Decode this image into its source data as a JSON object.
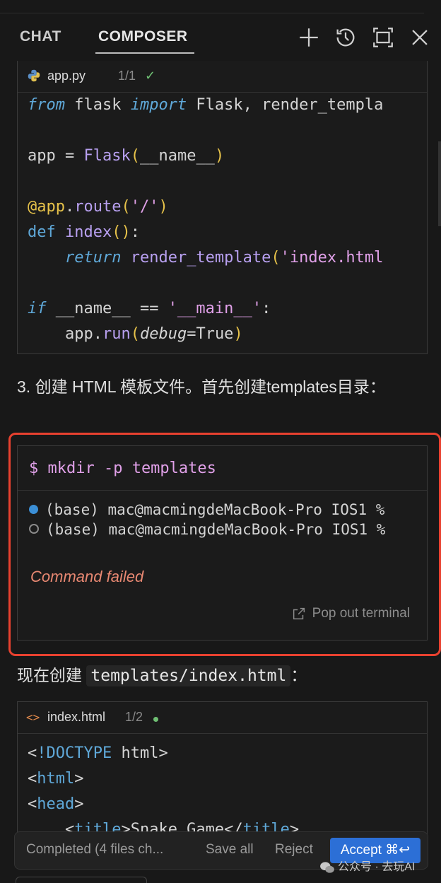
{
  "header": {
    "tabs": [
      {
        "label": "CHAT"
      },
      {
        "label": "COMPOSER"
      }
    ],
    "icons": [
      "plus-icon",
      "history-icon",
      "expand-icon",
      "close-icon"
    ]
  },
  "file1": {
    "name": "app.py",
    "count": "1/1",
    "check": "✓",
    "lines": [
      "from flask import Flask, render_templa",
      "",
      "app = Flask(__name__)",
      "",
      "@app.route('/')",
      "def index():",
      "    return render_template('index.html",
      "",
      "if __name__ == '__main__':",
      "    app.run(debug=True)"
    ]
  },
  "step3": "3. 创建 HTML 模板文件。首先创建templates目录：",
  "terminal": {
    "command": "$ mkdir -p templates",
    "lines": [
      "(base) mac@macmingdeMacBook-Pro IOS1 %",
      "(base) mac@macmingdeMacBook-Pro IOS1 %"
    ],
    "status": "Command failed",
    "popout": "Pop out terminal"
  },
  "now_create": {
    "prefix": "现在创建",
    "path": "templates/index.html",
    "suffix": "："
  },
  "file2": {
    "name": "index.html",
    "count": "1/2",
    "lines": [
      "<!DOCTYPE html>",
      "<html>",
      "<head>",
      "    <title>Snake Game</title>"
    ]
  },
  "bottombar": {
    "completed": "Completed (4 files ch...",
    "save_all": "Save all",
    "reject": "Reject",
    "accept": "Accept ⌘↩"
  },
  "watermark": "公众号 · 去玩AI"
}
